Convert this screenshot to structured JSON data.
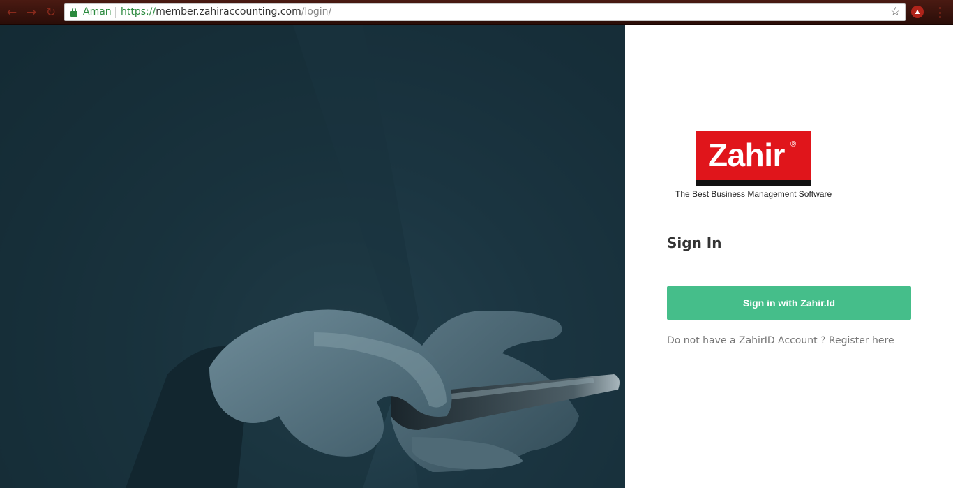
{
  "browser": {
    "secure_label": "Aman",
    "url_scheme": "https://",
    "url_host": "member.zahiraccounting.com",
    "url_path": "/login/",
    "icons": [
      "back-icon",
      "forward-icon",
      "reload-icon",
      "lock-icon",
      "star-icon",
      "extension-icon",
      "menu-icon"
    ]
  },
  "brand": {
    "logo_text": "Zahir",
    "registered_mark": "®",
    "tagline": "The Best Business Management Software",
    "logo_color": "#e0151b"
  },
  "signin": {
    "title": "Sign In",
    "button_label": "Sign in with Zahir.Id",
    "button_color": "#45be8a",
    "register_prompt": "Do not have a ZahirID Account ?",
    "register_link": "Register here"
  }
}
